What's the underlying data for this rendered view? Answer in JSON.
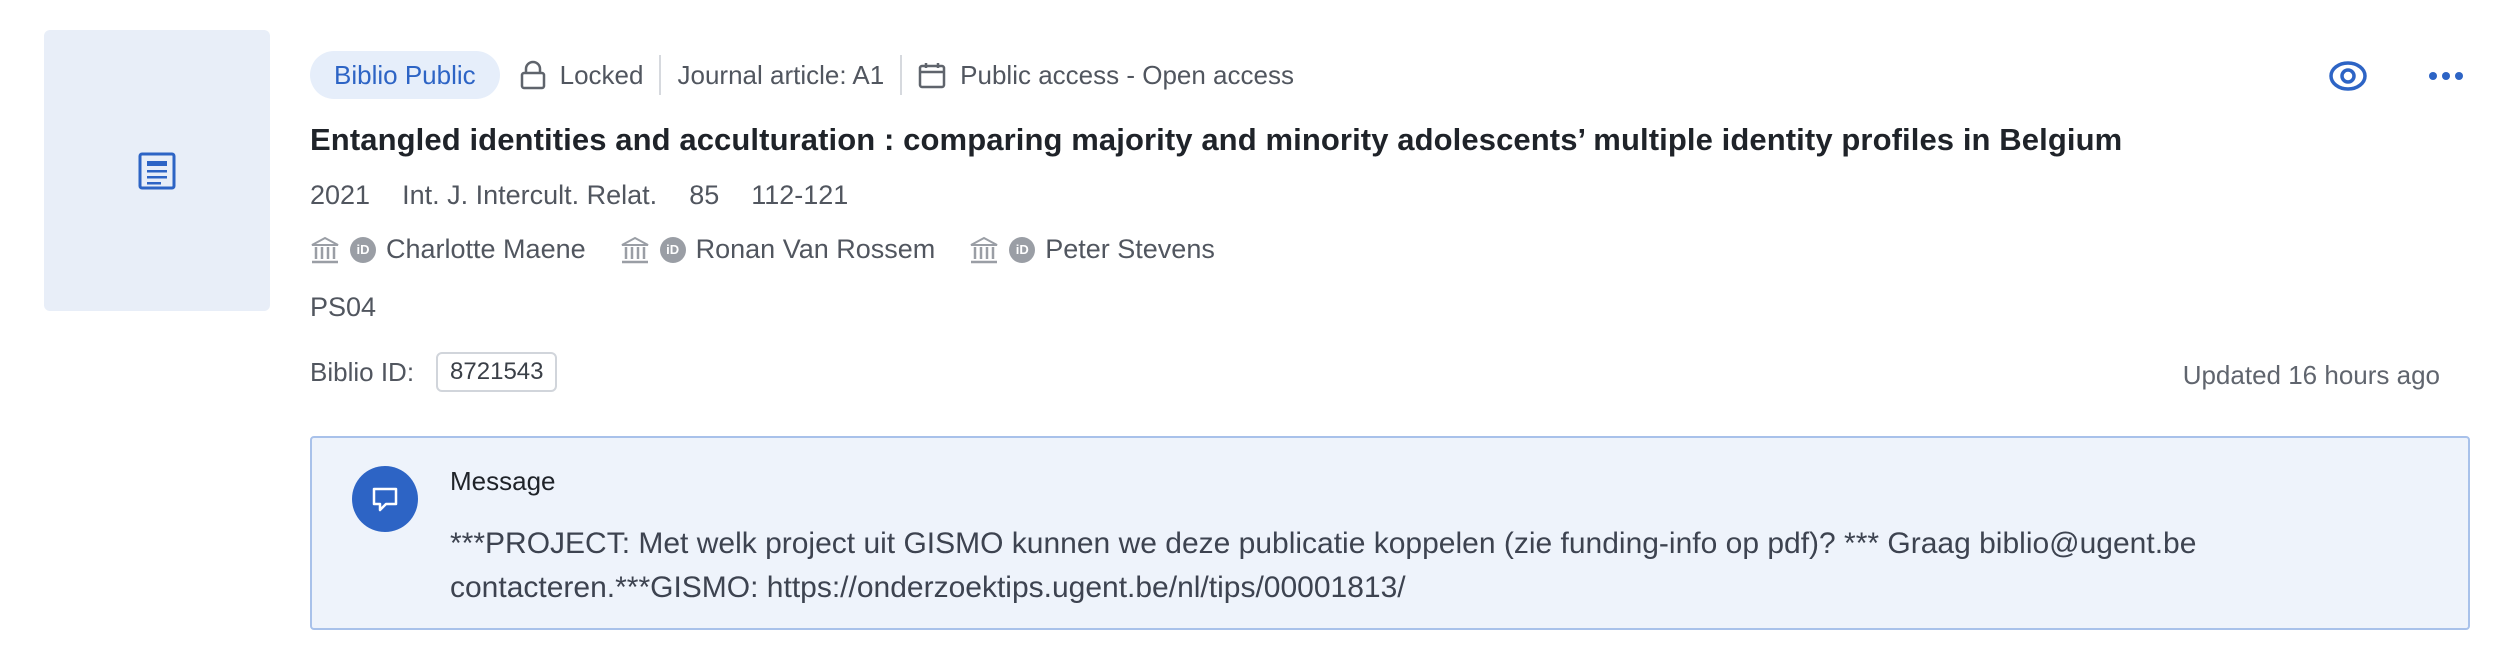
{
  "thumbnail": {
    "icon": "document-icon"
  },
  "meta": {
    "badge": "Biblio Public",
    "lock_status": "Locked",
    "type": "Journal article: A1",
    "access": "Public access - Open access"
  },
  "actions": {
    "view_icon": "eye-icon",
    "more_icon": "more-horizontal-icon"
  },
  "title": "Entangled identities and acculturation : comparing majority and minority adolescents’ multiple identity profiles in Belgium",
  "publication": {
    "year": "2021",
    "journal": "Int. J. Intercult. Relat.",
    "volume": "85",
    "pages": "112-121"
  },
  "authors": [
    {
      "name": "Charlotte Maene"
    },
    {
      "name": "Ronan Van Rossem"
    },
    {
      "name": "Peter Stevens"
    }
  ],
  "orcid_label": "iD",
  "department": "PS04",
  "biblio_id": {
    "label": "Biblio ID:",
    "value": "8721543"
  },
  "updated": "Updated 16 hours ago",
  "message": {
    "title": "Message",
    "body": "***PROJECT: Met welk project uit GISMO kunnen we deze publicatie koppelen (zie funding-info op pdf)? *** Graag biblio@ugent.be contacteren.***GISMO: https://onderzoektips.ugent.be/nl/tips/00001813/"
  },
  "colors": {
    "accent": "#2d64c5",
    "badge_bg": "#e6eefa",
    "message_bg": "#eef3fb",
    "message_border": "#a8c1ea"
  }
}
